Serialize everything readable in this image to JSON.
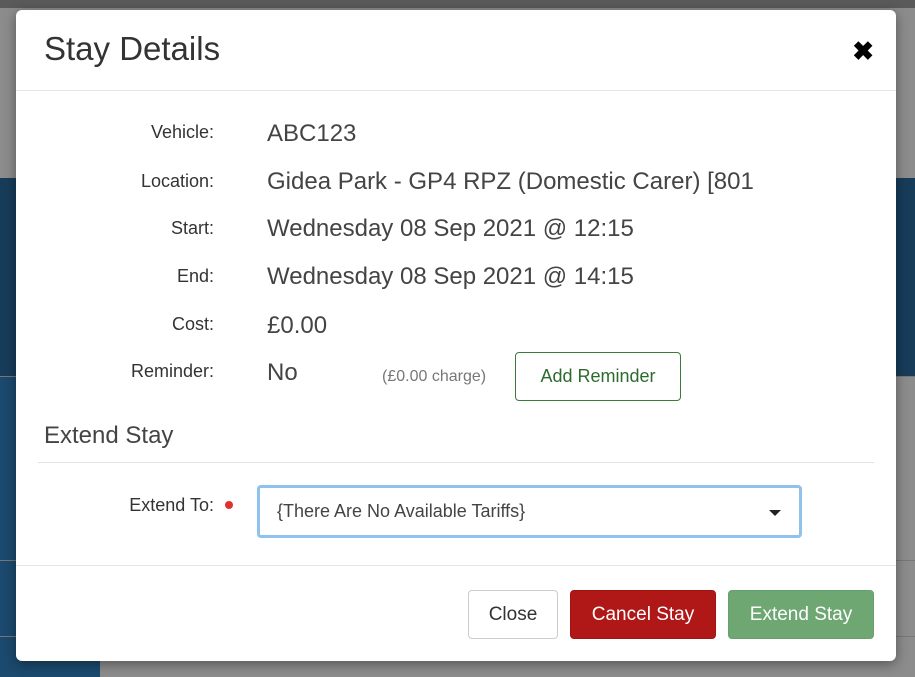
{
  "modal": {
    "title": "Stay Details",
    "close_glyph": "✖"
  },
  "details": {
    "vehicle_label": "Vehicle:",
    "vehicle_value": "ABC123",
    "location_label": "Location:",
    "location_value": "Gidea Park - GP4 RPZ (Domestic Carer) [801",
    "start_label": "Start:",
    "start_value": "Wednesday 08 Sep 2021 @ 12:15",
    "end_label": "End:",
    "end_value": "Wednesday 08 Sep 2021 @ 14:15",
    "cost_label": "Cost:",
    "cost_value": "£0.00",
    "reminder_label": "Reminder:",
    "reminder_value": "No",
    "reminder_charge": "(£0.00 charge)",
    "add_reminder_label": "Add Reminder"
  },
  "extend": {
    "section_title": "Extend Stay",
    "extend_to_label": "Extend To:",
    "selected_option": "{There Are No Available Tariffs}"
  },
  "footer": {
    "close_label": "Close",
    "cancel_label": "Cancel Stay",
    "extend_label": "Extend Stay"
  },
  "colors": {
    "cancel": "#b01818",
    "extend": "#6ea772",
    "reminder_border": "#3a7d3a",
    "required": "#e03030",
    "select_focus": "#8fc3ee"
  }
}
